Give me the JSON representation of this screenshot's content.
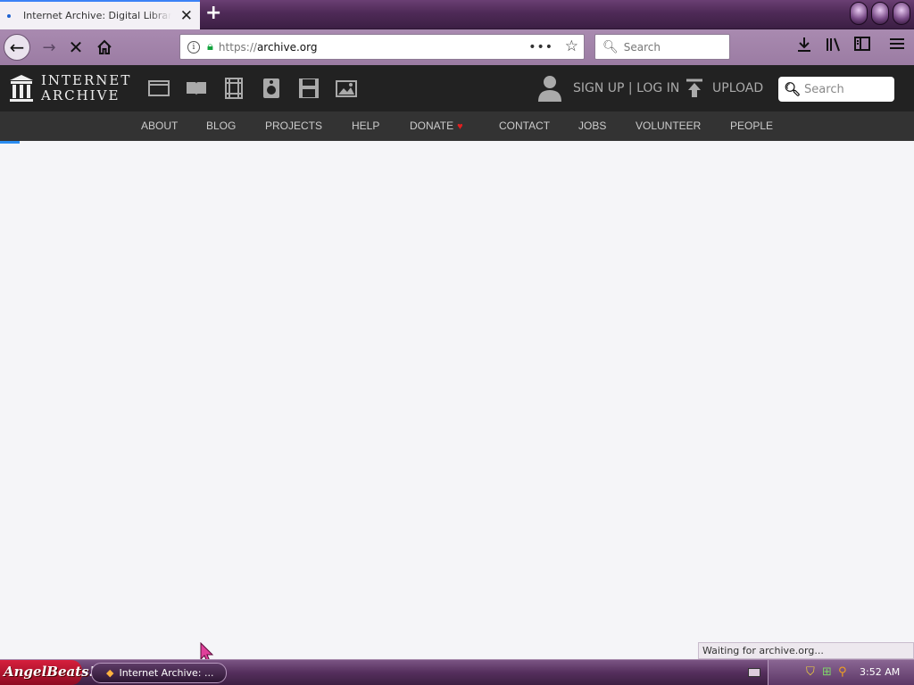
{
  "browser": {
    "tab": {
      "title": "Internet Archive: Digital Library of Free & Borrowable Books, Movies, Music & Wayback Machine"
    },
    "url": {
      "scheme": "https://",
      "host": "archive.org"
    },
    "search_placeholder": "Search",
    "status_text": "Waiting for archive.org..."
  },
  "site": {
    "logo": {
      "line1": "INTERNET",
      "line2": "ARCHIVE"
    },
    "media_icons": [
      "web-icon",
      "texts-icon",
      "video-icon",
      "audio-icon",
      "software-icon",
      "images-icon"
    ],
    "signin_label": "SIGN UP | LOG IN",
    "upload_label": "UPLOAD",
    "search_placeholder": "Search",
    "nav": [
      "ABOUT",
      "BLOG",
      "PROJECTS",
      "HELP",
      "DONATE",
      "CONTACT",
      "JOBS",
      "VOLUNTEER",
      "PEOPLE"
    ]
  },
  "taskbar": {
    "start_label": "AngelBeats!",
    "task_label": "Internet Archive: ...",
    "clock": "3:52 AM"
  },
  "colors": {
    "accent": "#2a8cf0",
    "heart": "#e21f1f",
    "chrome": "#9b7ca3",
    "site_header": "#222222"
  }
}
